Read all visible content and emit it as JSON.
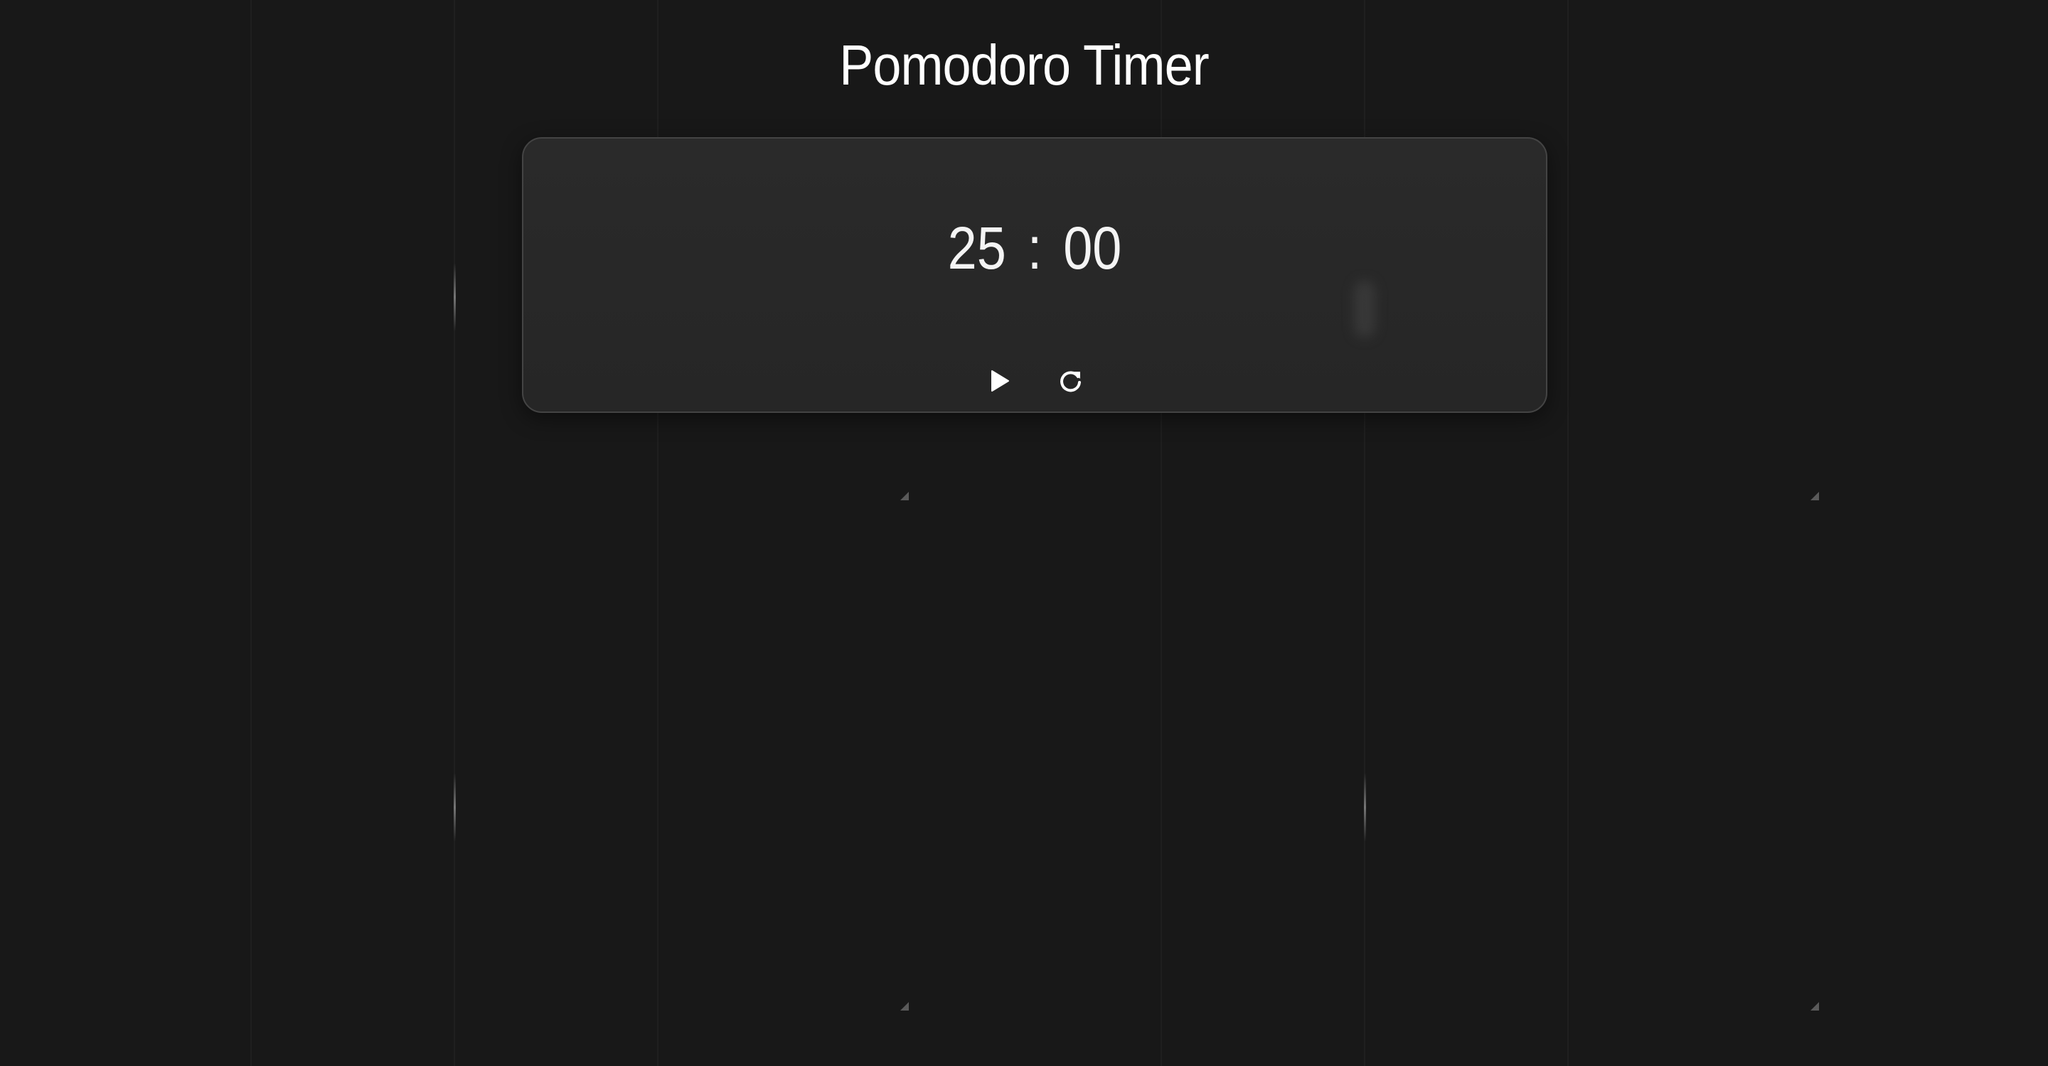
{
  "page": {
    "title": "Pomodoro Timer",
    "background_color": "#181818",
    "card_color": "#282828",
    "card_border_color": "#444444",
    "text_color": "#ffffff"
  },
  "timer": {
    "minutes": "25",
    "separator": ":",
    "seconds": "00"
  },
  "controls": {
    "play_icon": "play-icon",
    "reset_icon": "reset-icon"
  }
}
